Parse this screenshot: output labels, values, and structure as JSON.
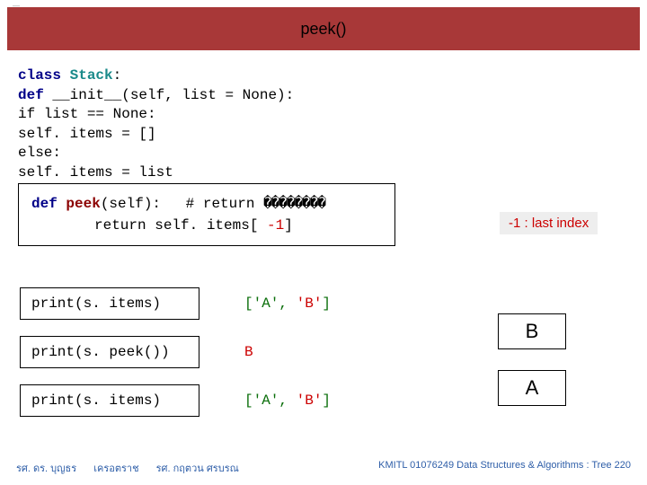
{
  "header": {
    "title": "peek()"
  },
  "code": {
    "l1a": "class ",
    "l1b": "Stack",
    "l1c": ":",
    "l2a": "   def ",
    "l2b": "__init__(self, list = None):",
    "l3": "      if list == None:",
    "l4": "         self. items = []",
    "l5": "      else:",
    "l6": "         self. items = list"
  },
  "method": {
    "sig_a": "def ",
    "sig_b": "peek",
    "sig_c": "(self):",
    "comm": "# return ",
    "squares": "��������",
    "ret_a": "return self. items[ ",
    "ret_b": "-1",
    "ret_c": "]"
  },
  "note": "-1 : last index",
  "prints": {
    "p1_call": "print(s. items)",
    "p1_out_a": "['A', ",
    "p1_out_b": "'B'",
    "p1_out_c": "]",
    "p2_call": "print(s. peek())",
    "p2_out": "B",
    "p3_call": "print(s. items)",
    "p3_out_a": "['A', ",
    "p3_out_b": "'B'",
    "p3_out_c": "]"
  },
  "stack": {
    "top": "B",
    "bottom": "A"
  },
  "footer": {
    "name1": "รศ. ดร. บุญธร",
    "name2": "เครอตราช",
    "name3": "รศ. กฤตวน  ศรบรณ",
    "right": "KMITL   01076249 Data Structures & Algorithms : Tree 220"
  }
}
